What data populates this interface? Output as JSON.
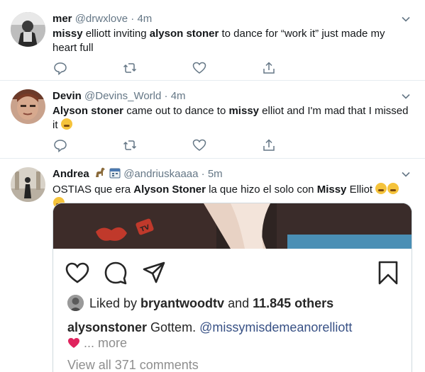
{
  "tweets": [
    {
      "name": "mer",
      "handle": "@drwxlove",
      "dot": "·",
      "time": "4m",
      "text_parts": [
        "missy",
        " elliott inviting ",
        "alyson stoner",
        " to dance for “work it” just made my heart full"
      ]
    },
    {
      "name": "Devin",
      "handle": "@Devins_World",
      "dot": "·",
      "time": "4m",
      "text_parts": [
        "Alyson stoner",
        " came out to dance to ",
        "missy",
        " elliot and I'm mad that I missed it"
      ]
    },
    {
      "name": "Andrea",
      "handle": "@andriuskaaaa",
      "dot": "·",
      "time": "5m",
      "text_parts": [
        "OSTIAS que era ",
        "Alyson Stoner",
        " la que hizo el solo con ",
        "Missy",
        " Elliot"
      ]
    }
  ],
  "instagram": {
    "liked_prefix": "Liked by ",
    "liked_user": "bryantwoodtv",
    "liked_and": " and ",
    "liked_others": "11.845 others",
    "caption_user": "alysonstoner",
    "caption_text": " Gottem. ",
    "caption_mention": "@missymisdemeanorelliott",
    "caption_more": " ... more",
    "view_all": "View all 371 comments"
  },
  "icons": {
    "chevron": "chevron-down-icon",
    "reply": "reply-icon",
    "retweet": "retweet-icon",
    "like": "heart-icon",
    "share": "share-icon"
  },
  "colors": {
    "icon": "#657786",
    "text": "#14171a",
    "muted": "#657786",
    "border": "#e6ecf0",
    "ig_text": "#262626",
    "ig_link": "#385185"
  }
}
